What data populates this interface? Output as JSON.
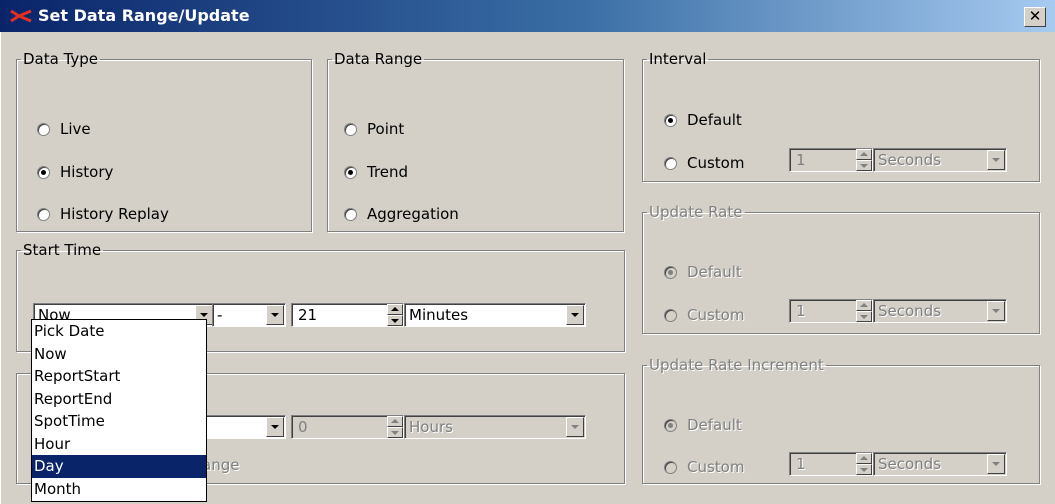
{
  "window": {
    "title": "Set Data Range/Update",
    "close_label": "✕"
  },
  "data_type": {
    "legend": "Data Type",
    "options": [
      {
        "label": "Live",
        "checked": false
      },
      {
        "label": "History",
        "checked": true
      },
      {
        "label": "History Replay",
        "checked": false
      }
    ]
  },
  "data_range": {
    "legend": "Data Range",
    "options": [
      {
        "label": "Point",
        "checked": false
      },
      {
        "label": "Trend",
        "checked": true
      },
      {
        "label": "Aggregation",
        "checked": false
      }
    ]
  },
  "interval": {
    "legend": "Interval",
    "default_label": "Default",
    "custom_label": "Custom",
    "default_checked": true,
    "value": "1",
    "unit": "Seconds"
  },
  "update_rate": {
    "legend": "Update Rate",
    "default_label": "Default",
    "custom_label": "Custom",
    "default_checked": true,
    "value": "1",
    "unit": "Seconds"
  },
  "update_rate_increment": {
    "legend": "Update Rate Increment",
    "default_label": "Default",
    "custom_label": "Custom",
    "default_checked": true,
    "value": "1",
    "unit": "Seconds"
  },
  "start_time": {
    "legend": "Start Time",
    "reference": "Now",
    "operator": "-",
    "amount": "21",
    "unit": "Minutes"
  },
  "end_time": {
    "operator": "",
    "amount": "0",
    "unit": "Hours",
    "partial_label": "ange"
  },
  "reference_dropdown": {
    "options": [
      "Pick Date",
      "Now",
      "ReportStart",
      "ReportEnd",
      "SpotTime",
      "Hour",
      "Day",
      "Month"
    ],
    "highlighted": "Day"
  },
  "colors": {
    "title_bar": "#0a246a",
    "highlight": "#0a246a",
    "face": "#d4d0c8"
  }
}
